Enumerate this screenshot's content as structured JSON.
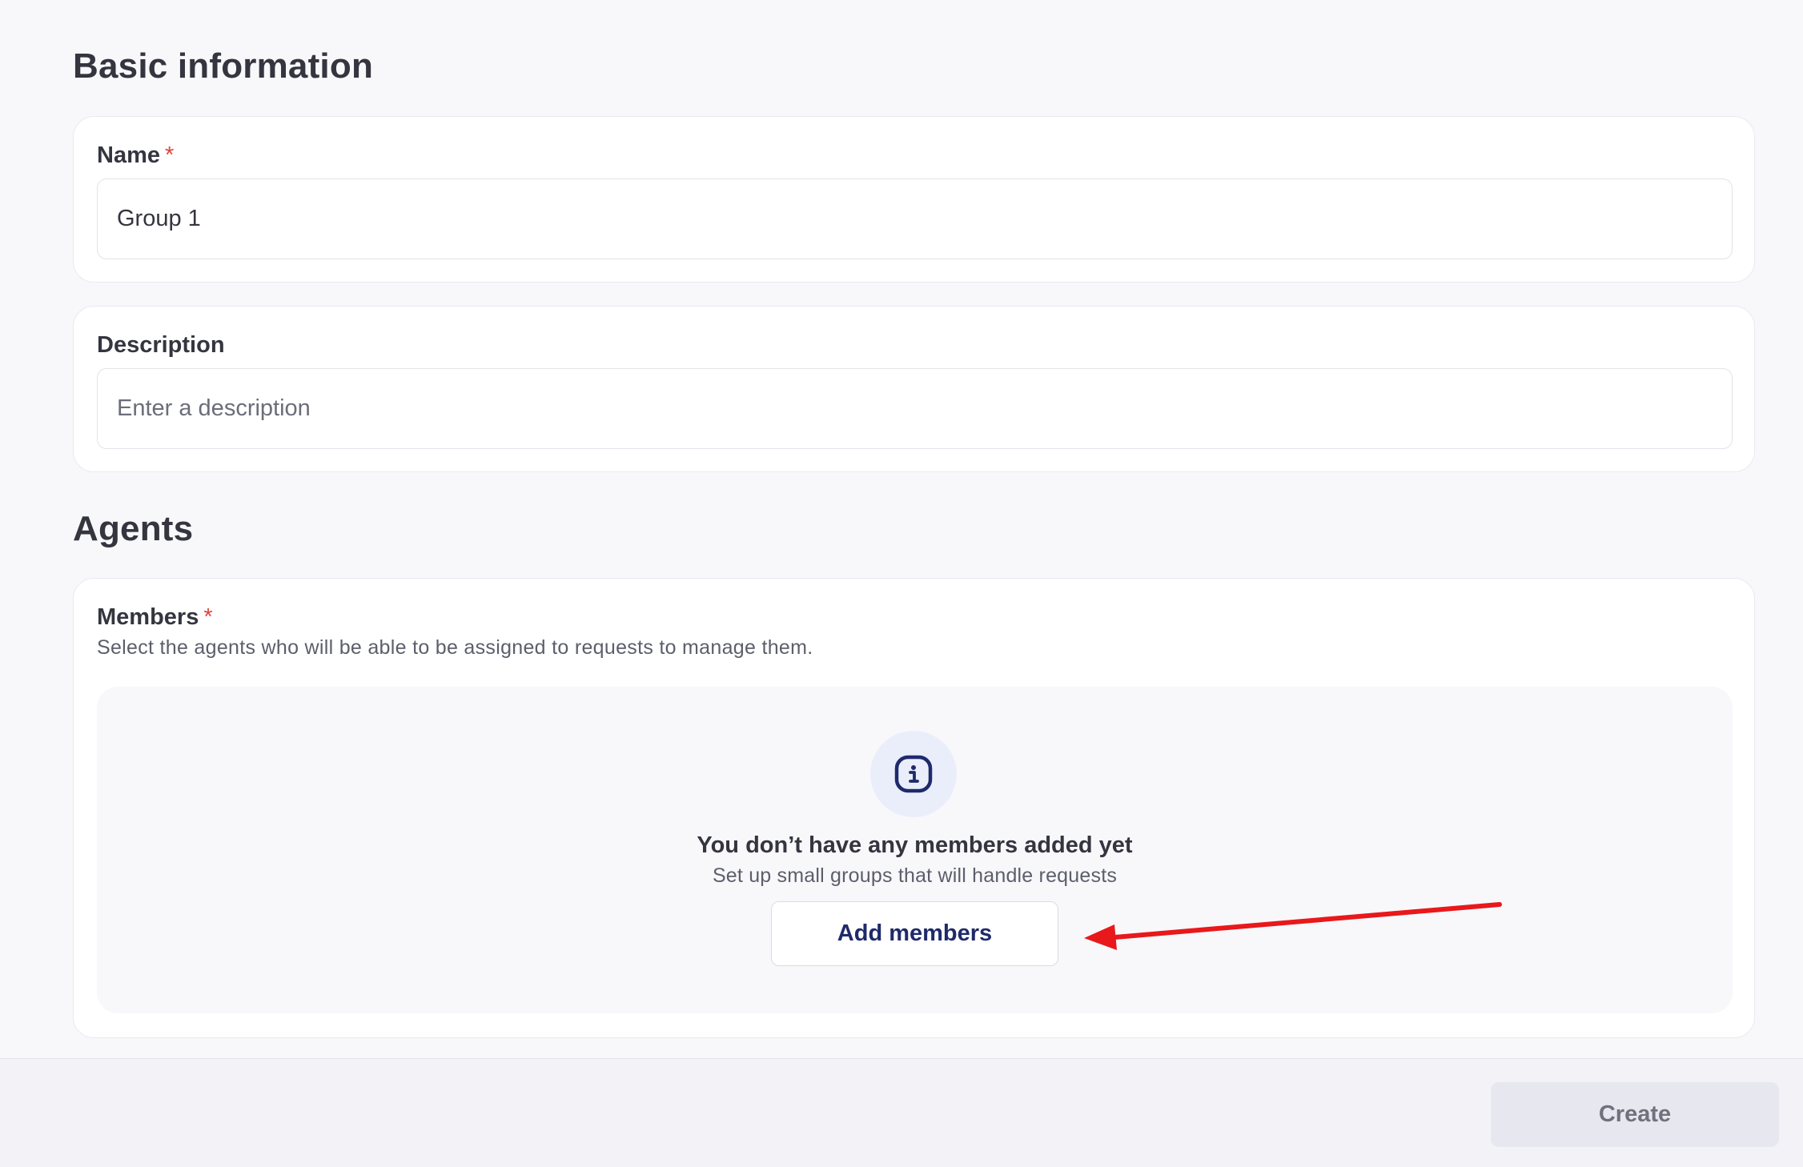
{
  "basic_information": {
    "title": "Basic information",
    "name_field": {
      "label": "Name",
      "required_marker": "*",
      "value": "Group 1"
    },
    "description_field": {
      "label": "Description",
      "placeholder": "Enter a description",
      "value": ""
    }
  },
  "agents": {
    "title": "Agents",
    "members": {
      "label": "Members",
      "required_marker": "*",
      "hint": "Select the agents who will be able to be assigned to requests to manage them.",
      "empty_state": {
        "icon": "info-icon",
        "title": "You don’t have any members added yet",
        "subtitle": "Set up small groups that will handle requests",
        "button_label": "Add members"
      }
    }
  },
  "annotation": {
    "arrow_color": "#e8181b"
  },
  "footer": {
    "create_label": "Create"
  },
  "colors": {
    "required_star": "#e0433c",
    "primary_text": "#34353f",
    "accent_navy": "#1f2a6b",
    "icon_bg": "#eaeefb"
  }
}
